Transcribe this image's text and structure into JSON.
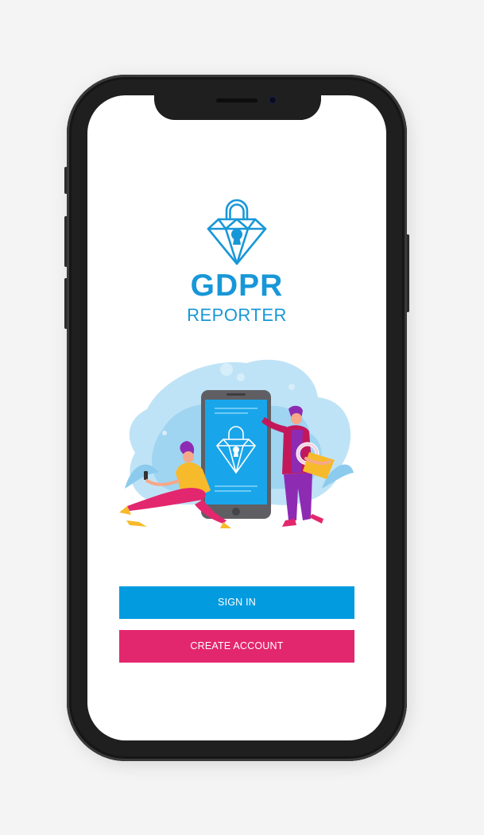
{
  "app": {
    "title": "GDPR",
    "subtitle": "REPORTER"
  },
  "logo": {
    "icon": "padlock-diamond-icon",
    "color": "#1897d8"
  },
  "illustration": {
    "icon": "people-with-phone-illustration"
  },
  "actions": {
    "sign_in_label": "SIGN IN",
    "create_account_label": "CREATE ACCOUNT"
  },
  "colors": {
    "brand_blue": "#1897d8",
    "sign_in_bg": "#039be0",
    "create_account_bg": "#e3276e"
  }
}
